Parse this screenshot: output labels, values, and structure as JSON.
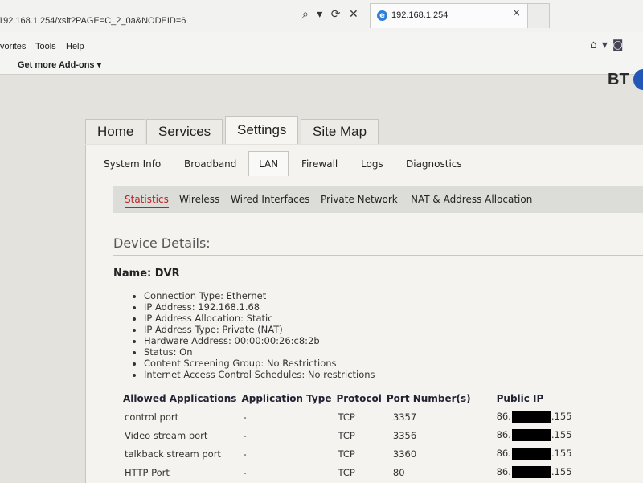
{
  "browser": {
    "url": "192.168.1.254/xslt?PAGE=C_2_0a&NODEID=6",
    "address_controls": "⌕ ▾ ⟳ ✕",
    "tab_title": "192.168.1.254",
    "tab_close": "×",
    "menu": [
      "vorites",
      "Tools",
      "Help"
    ],
    "favorites_addon": "Get more Add-ons ▾",
    "brand": "BT"
  },
  "nav": {
    "main_tabs": [
      "Home",
      "Services",
      "Settings",
      "Site Map"
    ],
    "active_main": "Settings",
    "sub_tabs": [
      "System Info",
      "Broadband",
      "LAN",
      "Firewall",
      "Logs",
      "Diagnostics"
    ],
    "active_sub": "LAN",
    "lan_tabs": [
      "Statistics",
      "Wireless",
      "Wired Interfaces",
      "Private Network",
      "NAT & Address Allocation"
    ],
    "active_lan": "Statistics"
  },
  "device": {
    "section_title": "Device Details:",
    "name_line": "Name: DVR",
    "details": [
      "Connection Type: Ethernet",
      "IP Address: 192.168.1.68",
      "IP Address Allocation: Static",
      "IP Address Type: Private (NAT)",
      "Hardware Address: 00:00:00:26:c8:2b",
      "Status: On",
      "Content Screening Group: No Restrictions",
      "Internet Access Control Schedules: No restrictions"
    ]
  },
  "apps_table": {
    "headers": [
      "Allowed Applications",
      "Application Type",
      "Protocol",
      "Port Number(s)",
      "Public IP"
    ],
    "rows": [
      {
        "app": "control port",
        "type": "-",
        "protocol": "TCP",
        "port": "3357",
        "ip_prefix": "86.",
        "ip_suffix": ".155"
      },
      {
        "app": "Video stream port",
        "type": "-",
        "protocol": "TCP",
        "port": "3356",
        "ip_prefix": "86.",
        "ip_suffix": ".155"
      },
      {
        "app": "talkback stream port",
        "type": "-",
        "protocol": "TCP",
        "port": "3360",
        "ip_prefix": "86.",
        "ip_suffix": ".155"
      },
      {
        "app": "HTTP Port",
        "type": "-",
        "protocol": "TCP",
        "port": "80",
        "ip_prefix": "86.",
        "ip_suffix": ".155"
      }
    ]
  },
  "colors": {
    "active_lan_tab": "#b22222",
    "redaction": "#000000"
  }
}
